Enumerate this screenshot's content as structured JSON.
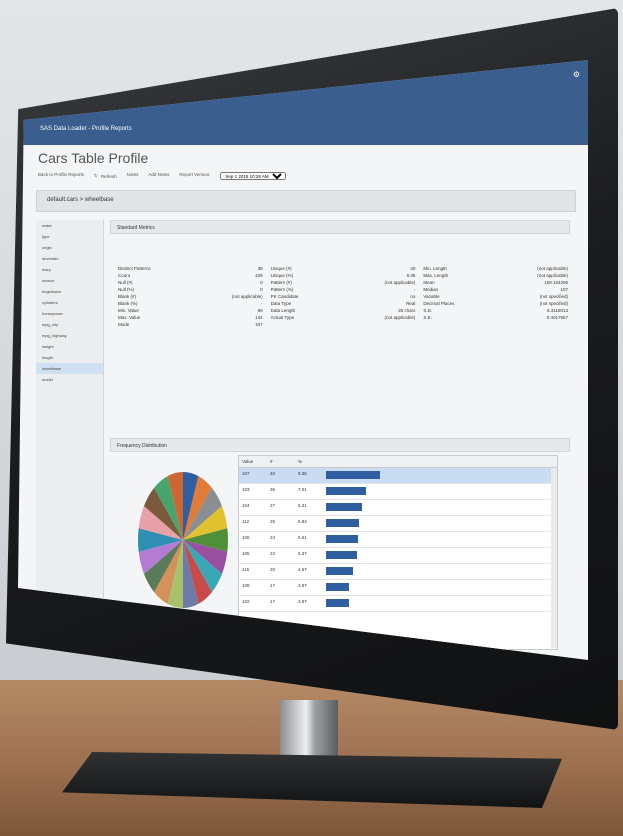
{
  "app": {
    "title": "SAS Data Loader - Profile Reports",
    "user": "⚙"
  },
  "page": {
    "title": "Cars Table Profile",
    "toolbar": {
      "back_label": "Back to Profile Reports",
      "refresh_label": "Refresh",
      "notes_label": "Notes",
      "add_notes_label": "Add Notes",
      "report_label": "Report Version:",
      "report_value": "Sep 1 2015 10:28 AM"
    },
    "table_path": "default.cars > wheelbase"
  },
  "sidebar": {
    "items": [
      "make",
      "type",
      "origin",
      "drivetrain",
      "msrp",
      "invoice",
      "enginesize",
      "cylinders",
      "horsepower",
      "mpg_city",
      "mpg_highway",
      "weight",
      "length",
      "wheelbase",
      "model"
    ],
    "active_index": 13
  },
  "sections": {
    "stats_title": "Standard Metrics",
    "freq_title": "Frequency Distribution"
  },
  "stats": {
    "col1": [
      {
        "k": "Distinct Patterns",
        "v": "38"
      },
      {
        "k": "Count",
        "v": "428"
      },
      {
        "k": "Null (#)",
        "v": "0"
      },
      {
        "k": "Null (%)",
        "v": "0"
      },
      {
        "k": "Blank (#)",
        "v": "(not applicable)"
      },
      {
        "k": "Blank (%)",
        "v": "-"
      },
      {
        "k": "Min. Value",
        "v": "89"
      },
      {
        "k": "Max. Value",
        "v": "144"
      },
      {
        "k": "Mode",
        "v": "107"
      }
    ],
    "col2": [
      {
        "k": "Unique (#)",
        "v": "40"
      },
      {
        "k": "Unique (%)",
        "v": "9.35"
      },
      {
        "k": "Pattern (#)",
        "v": "(not applicable)"
      },
      {
        "k": "Pattern (%)",
        "v": "-"
      },
      {
        "k": "PK Candidate",
        "v": "no"
      },
      {
        "k": "Data Type",
        "v": "Real"
      },
      {
        "k": "Data Length",
        "v": "35 chars"
      },
      {
        "k": "Actual Type",
        "v": "(not applicable)"
      }
    ],
    "col3": [
      {
        "k": "Min. Length",
        "v": "(not applicable)"
      },
      {
        "k": "Max. Length",
        "v": "(not applicable)"
      },
      {
        "k": "Mean",
        "v": "108.154206"
      },
      {
        "k": "Median",
        "v": "107"
      },
      {
        "k": "Variable",
        "v": "(not specified)"
      },
      {
        "k": "Decimal Places",
        "v": "(not specified)"
      },
      {
        "k": "S.D.",
        "v": "8.3118013"
      },
      {
        "k": "S.E.",
        "v": "0.4017567"
      }
    ]
  },
  "freq": {
    "headers": [
      "Value",
      "#",
      "%",
      ""
    ],
    "rows": [
      {
        "v": "107",
        "n": "40",
        "p": "9.35",
        "frac": 0.094
      },
      {
        "v": "103",
        "n": "36",
        "p": "7.01",
        "frac": 0.07
      },
      {
        "v": "104",
        "n": "27",
        "p": "6.31",
        "frac": 0.063
      },
      {
        "v": "112",
        "n": "25",
        "p": "5.84",
        "frac": 0.058
      },
      {
        "v": "106",
        "n": "24",
        "p": "5.61",
        "frac": 0.056
      },
      {
        "v": "105",
        "n": "23",
        "p": "5.37",
        "frac": 0.054
      },
      {
        "v": "115",
        "n": "20",
        "p": "4.67",
        "frac": 0.047
      },
      {
        "v": "108",
        "n": "17",
        "p": "3.97",
        "frac": 0.04
      },
      {
        "v": "102",
        "n": "17",
        "p": "3.97",
        "frac": 0.04
      }
    ]
  },
  "pie_colors": [
    "#2f5fa0",
    "#e07b39",
    "#8a8f94",
    "#e0c22f",
    "#4f8f3a",
    "#9a4fa0",
    "#3aa7b5",
    "#c94a4a",
    "#6c7ba8",
    "#a8c26c",
    "#d4915a",
    "#5a7a5a",
    "#b37bd4",
    "#2f8fb3",
    "#e8a0a8",
    "#7a5a3a",
    "#46a46c",
    "#cc6633"
  ]
}
